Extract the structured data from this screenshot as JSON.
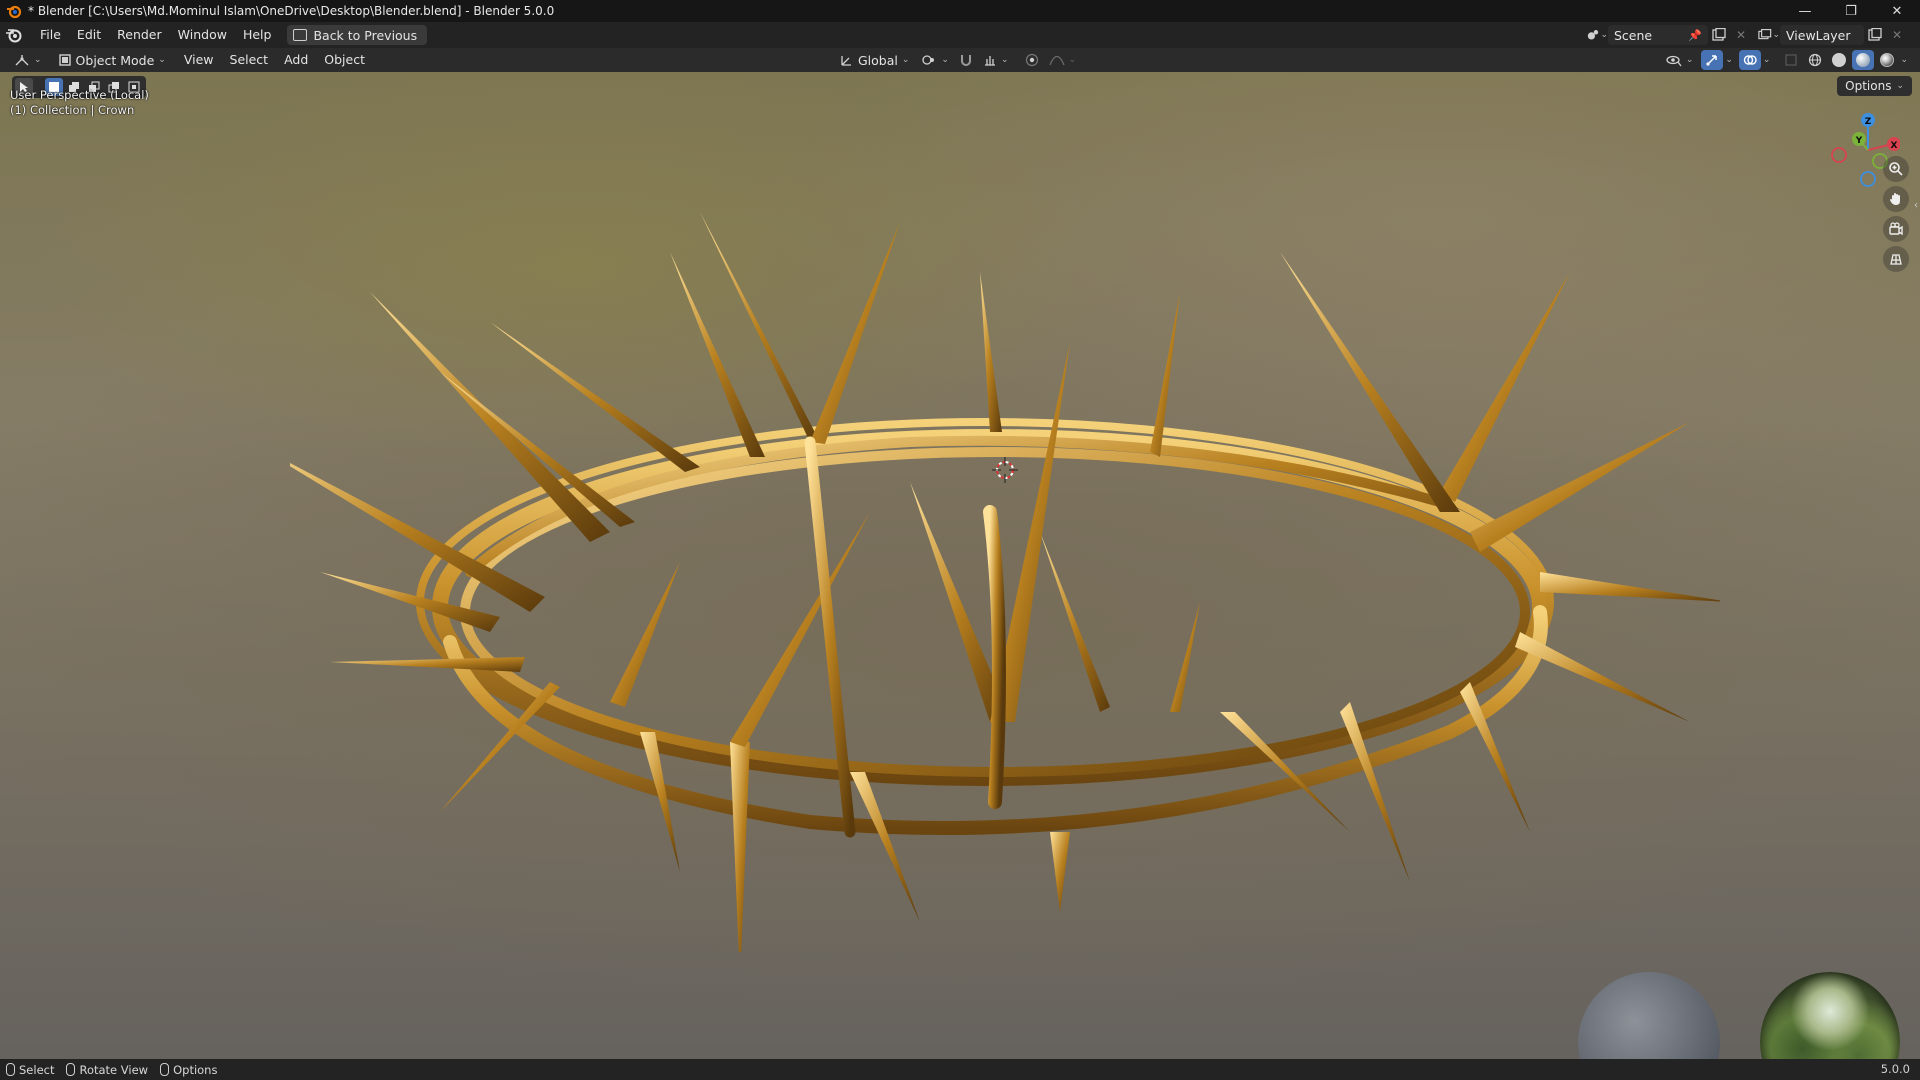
{
  "window": {
    "title": "* Blender [C:\\Users\\Md.Mominul Islam\\OneDrive\\Desktop\\Blender.blend] - Blender 5.0.0",
    "controls": {
      "minimize": "—",
      "restore": "❐",
      "close": "✕"
    }
  },
  "topbar": {
    "menus": [
      "File",
      "Edit",
      "Render",
      "Window",
      "Help"
    ],
    "back_button": "Back to Previous",
    "scene": "Scene",
    "view_layer": "ViewLayer"
  },
  "viewport_header": {
    "mode": "Object Mode",
    "menus": [
      "View",
      "Select",
      "Add",
      "Object"
    ],
    "transform_orientation": "Global"
  },
  "viewport": {
    "perspective_label": "User Perspective (Local)",
    "collection_label": "(1) Collection | Crown",
    "options_label": "Options",
    "gizmo_axes": {
      "z": "Z",
      "y": "Y",
      "x": "X"
    },
    "colors": {
      "x_axis": "#d8434f",
      "y_axis": "#7ab23a",
      "z_axis": "#3d8fe0",
      "gold": "#c8902a"
    }
  },
  "statusbar": {
    "items": [
      "Select",
      "Rotate View",
      "Options"
    ],
    "version": "5.0.0"
  }
}
